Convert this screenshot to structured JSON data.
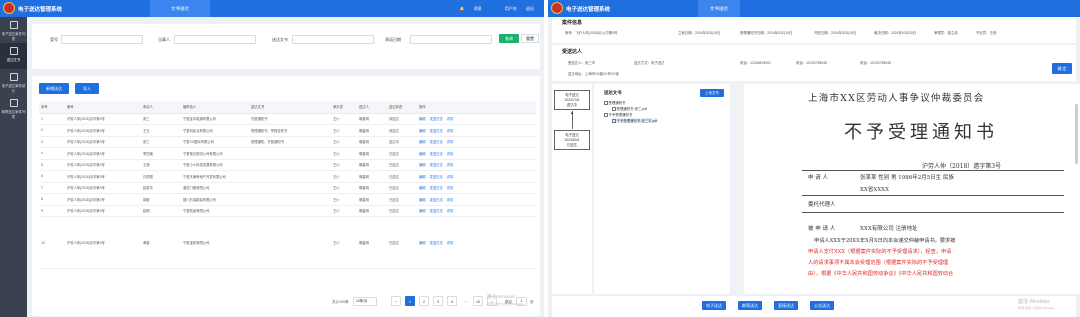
{
  "app": {
    "title": "电子送达管理系统",
    "tab": "文书送达",
    "top_actions": [
      "消息",
      "用户名",
      "退出"
    ]
  },
  "sidebar": {
    "items": [
      {
        "label": "电子送达案件列表",
        "icon": "list-icon"
      },
      {
        "label": "送达文书",
        "icon": "document-icon"
      },
      {
        "label": "电子送达案件统计",
        "icon": "chart-icon"
      },
      {
        "label": "邮寄送达案件列表",
        "icon": "mail-icon"
      }
    ]
  },
  "filters": {
    "case_no_label": "案号",
    "applicant_label": "当事人",
    "doc_label": "送达文书",
    "date_label": "承诺日期",
    "search_button": "查询",
    "reset_button": "重置"
  },
  "toolbar": {
    "batch_button": "新增送达",
    "import_button": "导入"
  },
  "table": {
    "headers": [
      "序号",
      "案号",
      "申请人",
      "被申请人",
      "送达文书",
      "承办员",
      "送达人",
      "送达状态",
      "操作"
    ],
    "rows": [
      {
        "no": "1",
        "case": "沪劳人仲(2018)办字第3号",
        "applicant": "张三",
        "respondent": "宁夏金丰能源有限公司",
        "docs": "开庭通知书",
        "clerk": "王小",
        "sender": "明星明",
        "status": "待送达"
      },
      {
        "no": "2",
        "case": "沪劳人仲(2018)办字第3号",
        "applicant": "王五",
        "respondent": "宁夏利民北有限公司",
        "docs": "受理通知书、举报告知书",
        "clerk": "王小",
        "sender": "明星明",
        "status": "待送达"
      },
      {
        "no": "3",
        "case": "沪劳人仲(2018)办字第3号",
        "applicant": "张三",
        "respondent": "宁夏XX国际有限公司",
        "docs": "受理通知、开庭通知书",
        "clerk": "王小",
        "sender": "明星明",
        "status": "送达中"
      },
      {
        "no": "4",
        "case": "沪劳人仲(2018)办字第3号",
        "applicant": "李四第",
        "respondent": "宁夏第五物流公司有限公司",
        "docs": "",
        "clerk": "王小",
        "sender": "明星明",
        "status": "已送达"
      },
      {
        "no": "5",
        "case": "沪劳人仲(2018)办字第3号",
        "applicant": "王静",
        "respondent": "宁夏小小科技发展有限公司",
        "docs": "",
        "clerk": "王小",
        "sender": "明星明",
        "status": "已送达"
      },
      {
        "no": "6",
        "case": "沪劳人仲(2018)办字第3号",
        "applicant": "孔丽丽",
        "respondent": "宁夏天津房地产开发有限公司",
        "docs": "",
        "clerk": "王小",
        "sender": "明星明",
        "status": "已送达"
      },
      {
        "no": "7",
        "case": "沪劳人仲(2018)办字第3号",
        "applicant": "赵俊华",
        "respondent": "重庆门窗有限公司",
        "docs": "",
        "clerk": "王小",
        "sender": "明星明",
        "status": "已送达"
      },
      {
        "no": "8",
        "case": "沪劳人仲(2018)办字第3号",
        "applicant": "郭毅",
        "respondent": "银川石油勘探有限公司",
        "docs": "",
        "clerk": "王小",
        "sender": "明星明",
        "status": "已送达"
      },
      {
        "no": "9",
        "case": "沪劳人仲(2018)办字第3号",
        "applicant": "赵明",
        "respondent": "宁夏精品有限公司",
        "docs": "",
        "clerk": "王小",
        "sender": "明星明",
        "status": "已送达"
      },
      {
        "no": "10",
        "case": "沪劳人仲(2018)办字第3号",
        "applicant": "黄馨",
        "respondent": "宁夏金拓有限公司",
        "docs": "",
        "clerk": "王小",
        "sender": "明星明",
        "status": "已送达"
      }
    ],
    "actions": [
      "编辑",
      "发送日志",
      "详情"
    ]
  },
  "pager": {
    "total": "共计100条",
    "page_size": "10条/页",
    "pages": [
      "1",
      "2",
      "3",
      "4",
      "…",
      "10"
    ],
    "prev": "‹",
    "next": "›",
    "goto_label": "跳至",
    "goto_value": "1",
    "page_unit": "页",
    "watermark": "激活 Windows",
    "watermark_sub": "转到\"设置\"以激活 Windows。"
  },
  "detail": {
    "section_case": "案件信息",
    "case_info": [
      "案号：飞沪人仲(2018)办公中第3号",
      "立案日期：2024年02月15日",
      "受理通知书日期：2024年02月15日",
      "开庭日期：2024年02月15日",
      "裁决日期：2024年02月15日",
      "审理员：姚立伟",
      "书记员：王杨"
    ],
    "section_recipient": "受送达人",
    "recipient_info": [
      "受送达人：张三丰",
      "送达方式：电子送达",
      "电话：12345678901",
      "电话：15230738948",
      "电话：15230738948"
    ],
    "address": "送达地址：上海市XX路XX号XX室",
    "confirm_button": "确 定",
    "flow_top": [
      "电子送达",
      "2024/7/01",
      "送达中"
    ],
    "flow_bottom": [
      "电子送达",
      "2024/5/01",
      "已送达"
    ],
    "docs_title": "送达文书",
    "upload_button": "上传文书",
    "doc_tree": [
      "受理通知书",
      "受理通知书-张三.pdf",
      "不予受理通知书",
      "不予受理通知书-张三丰.pdf"
    ],
    "bottom_buttons": [
      "电子送达",
      "邮寄送达",
      "直接送达",
      "公告送达"
    ],
    "watermark": "激活 Windows",
    "watermark_sub": "转到\"设置\"以激活 Windows。"
  },
  "document": {
    "org": "上海市XX区劳动人事争议仲裁委员会",
    "title": "不予受理通知书",
    "number": "沪劳人仲（2018）遗字第3号",
    "row1_label": "申  请  人",
    "row1_value": "张某某    性别 男    1986年2月5日生  民族",
    "row1_addr": "XX省XXXX",
    "row2_label": "委托代理人",
    "row3_label": "被  申  请  人",
    "row3_value": "XXX有限公司    注册地址",
    "para1": "申请人XXX于20XX年X月X日向本会递交仲裁申请书，要求被",
    "para2": "申请人支付XXX（根据案件实际的不予受理请求），经查，申请",
    "para3": "人的请求事项不属本会受理范围（根据案件实际的不予受理理",
    "para4": "由），根据《中华人民共和国劳动争议》《中华人民共和国劳动合"
  },
  "colors": {
    "primary": "#1f6fe0",
    "sidebar": "#3a4250",
    "search_green": "#19b26b",
    "seal_red": "#c9302c",
    "doc_red": "#e02a2a"
  }
}
